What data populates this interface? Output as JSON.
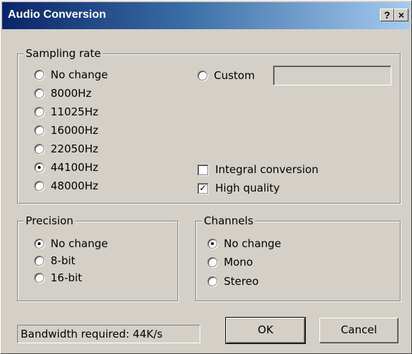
{
  "window": {
    "title": "Audio Conversion",
    "help_button": "?",
    "close_button": "×"
  },
  "sampling_rate": {
    "label": "Sampling rate",
    "options": [
      {
        "label": "No change",
        "selected": false
      },
      {
        "label": "8000Hz",
        "selected": false
      },
      {
        "label": "11025Hz",
        "selected": false
      },
      {
        "label": "16000Hz",
        "selected": false
      },
      {
        "label": "22050Hz",
        "selected": false
      },
      {
        "label": "44100Hz",
        "selected": true
      },
      {
        "label": "48000Hz",
        "selected": false
      }
    ],
    "custom": {
      "label": "Custom",
      "selected": false,
      "value": ""
    },
    "integral_conversion": {
      "label": "Integral conversion",
      "checked": false
    },
    "high_quality": {
      "label": "High quality",
      "checked": true
    }
  },
  "precision": {
    "label": "Precision",
    "options": [
      {
        "label": "No change",
        "selected": true
      },
      {
        "label": "8-bit",
        "selected": false
      },
      {
        "label": "16-bit",
        "selected": false
      }
    ]
  },
  "channels": {
    "label": "Channels",
    "options": [
      {
        "label": "No change",
        "selected": true
      },
      {
        "label": "Mono",
        "selected": false
      },
      {
        "label": "Stereo",
        "selected": false
      }
    ]
  },
  "status": {
    "bandwidth": "Bandwidth required: 44K/s"
  },
  "buttons": {
    "ok": "OK",
    "cancel": "Cancel"
  }
}
